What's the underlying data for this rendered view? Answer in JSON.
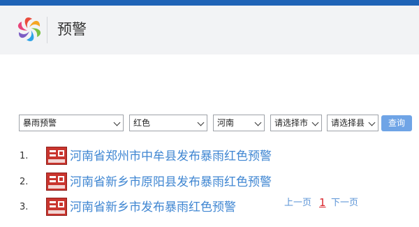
{
  "header": {
    "title": "预警",
    "logo_icon": "rainbow-logo-icon"
  },
  "filters": {
    "type": "暴雨预警",
    "color": "红色",
    "province": "河南",
    "city": "请选择市",
    "county": "请选择县",
    "query_label": "查询"
  },
  "warnings": [
    {
      "num": "1.",
      "title": "河南省郑州市中牟县发布暴雨红色预警",
      "icon": "rainstorm-red-warning-icon"
    },
    {
      "num": "2.",
      "title": "河南省新乡市原阳县发布暴雨红色预警",
      "icon": "rainstorm-red-warning-icon"
    },
    {
      "num": "3.",
      "title": "河南省新乡市发布暴雨红色预警",
      "icon": "rainstorm-red-warning-icon"
    }
  ],
  "pager": {
    "prev": "上一页",
    "current": "1",
    "next": "下一页"
  },
  "colors": {
    "top_bar": "#1f63b6",
    "link": "#3f86d2",
    "query_button": "#6fa4e6",
    "current_page": "#d9242b",
    "warning_icon": "#c9352e"
  }
}
